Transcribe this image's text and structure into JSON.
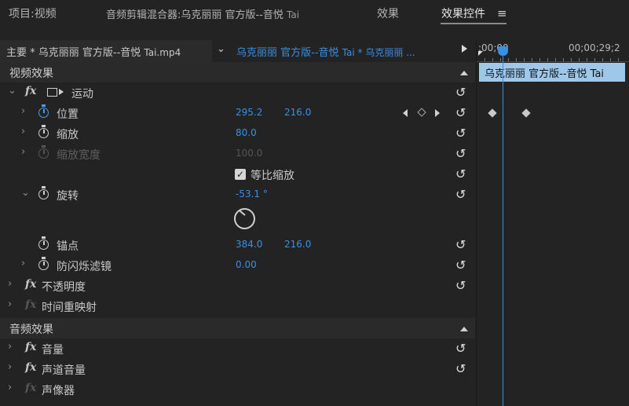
{
  "tabs": {
    "project": "项目:视频",
    "mixer": "音频剪辑混合器:乌克丽丽 官方版--音悦",
    "mixer_sub": "Tai",
    "effects": "效果",
    "effect_controls": "效果控件",
    "menu_icon": "hamburger-icon"
  },
  "sequence": {
    "master_label": "主要 * 乌克丽丽 官方版--音悦",
    "master_file": "Tai.mp4",
    "clip_link": "乌克丽丽 官方版--音悦",
    "clip_link_sub": "Tai * 乌克丽丽 ..."
  },
  "video_effects": {
    "header": "视频效果",
    "motion": {
      "label": "运动",
      "position": {
        "label": "位置",
        "x": "295.2",
        "y": "216.0"
      },
      "scale": {
        "label": "缩放",
        "value": "80.0"
      },
      "scale_width": {
        "label": "缩放宽度",
        "value": "100.0"
      },
      "uniform_scale": {
        "label": "等比缩放",
        "checked": true
      },
      "rotation": {
        "label": "旋转",
        "value": "-53.1 °"
      },
      "anchor": {
        "label": "锚点",
        "x": "384.0",
        "y": "216.0"
      },
      "antiflicker": {
        "label": "防闪烁滤镜",
        "value": "0.00"
      }
    },
    "opacity": {
      "label": "不透明度"
    },
    "time_remap": {
      "label": "时间重映射"
    }
  },
  "audio_effects": {
    "header": "音频效果",
    "volume": {
      "label": "音量"
    },
    "channel_volume": {
      "label": "声道音量"
    },
    "panner": {
      "label": "声像器"
    }
  },
  "timeline": {
    "tc_start": ";00;00",
    "tc_end": "00;00;29;2",
    "clip_name": "乌克丽丽 官方版--音悦",
    "clip_name_sub": "Tai"
  },
  "colors": {
    "accent_blue": "#3b8fe3",
    "clip_bar": "#9ec7ea",
    "background": "#232323"
  }
}
